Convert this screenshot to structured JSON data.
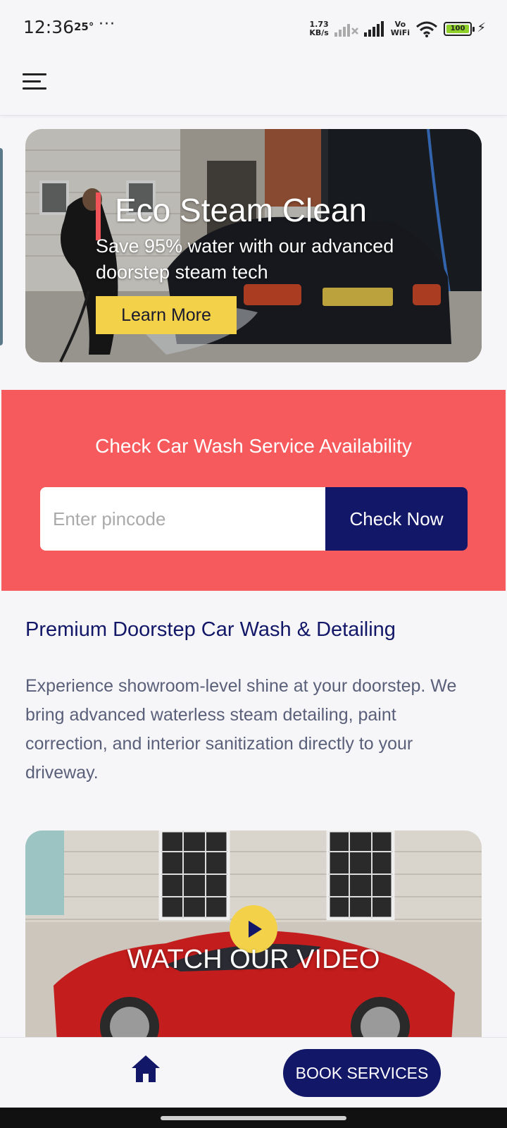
{
  "status_bar": {
    "time": "12:36",
    "temperature": "25°",
    "more": "···",
    "net_speed_value": "1.73",
    "net_speed_unit": "KB/s",
    "vowifi_top": "Vo",
    "vowifi_bottom": "WiFi",
    "battery": "100"
  },
  "header": {
    "menu_icon": "hamburger-menu-icon"
  },
  "hero": {
    "title": "Eco Steam Clean",
    "subtitle": "Save 95% water with our advanced doorstep steam tech",
    "cta_label": "Learn More"
  },
  "availability": {
    "title": "Check Car Wash Service Availability",
    "input_placeholder": "Enter pincode",
    "input_value": "",
    "button_label": "Check Now"
  },
  "intro": {
    "title": "Premium Doorstep Car Wash & Detailing",
    "body": "Experience showroom-level shine at your doorstep. We bring advanced waterless steam detailing, paint correction, and interior sanitization directly to your driveway."
  },
  "video": {
    "label": "WATCH OUR VIDEO",
    "play_icon": "play-icon"
  },
  "bottom_nav": {
    "home_icon": "home-icon",
    "book_label": "BOOK SERVICES"
  },
  "colors": {
    "accent_red": "#f65a5c",
    "navy": "#121768",
    "yellow": "#f3d249"
  }
}
